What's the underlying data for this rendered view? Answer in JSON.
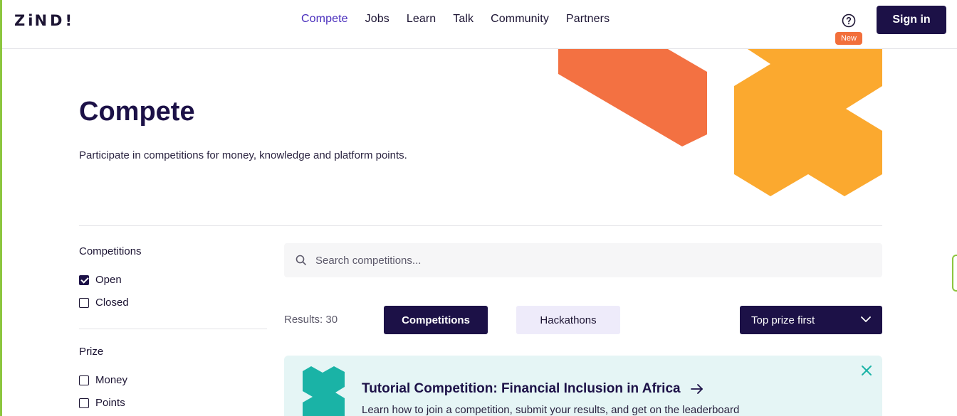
{
  "header": {
    "logo_text": "ZiND!",
    "nav": [
      {
        "label": "Compete",
        "active": true
      },
      {
        "label": "Jobs"
      },
      {
        "label": "Learn"
      },
      {
        "label": "Talk"
      },
      {
        "label": "Community"
      },
      {
        "label": "Partners"
      }
    ],
    "help_icon": "question-circle-icon",
    "new_badge": "New",
    "sign_in": "Sign in"
  },
  "hero": {
    "title": "Compete",
    "subtitle": "Participate in competitions for money, knowledge and platform points."
  },
  "filters": {
    "competitions": {
      "title": "Competitions",
      "options": [
        {
          "label": "Open",
          "checked": true
        },
        {
          "label": "Closed",
          "checked": false
        }
      ]
    },
    "prize": {
      "title": "Prize",
      "options": [
        {
          "label": "Money",
          "checked": false
        },
        {
          "label": "Points",
          "checked": false
        }
      ]
    }
  },
  "search": {
    "placeholder": "Search competitions..."
  },
  "results": {
    "label": "Results: 30",
    "tabs": [
      {
        "label": "Competitions",
        "active": true
      },
      {
        "label": "Hackathons",
        "active": false
      }
    ],
    "sort_value": "Top prize first"
  },
  "banner": {
    "title": "Tutorial Competition: Financial Inclusion in Africa",
    "description": "Learn how to join a competition, submit your results, and get on the leaderboard"
  },
  "colors": {
    "brand_dark": "#1c1147",
    "accent_purple": "#4a2fbd",
    "orange": "#f26f3b",
    "amber": "#fba92f",
    "teal": "#1ab3a6"
  }
}
